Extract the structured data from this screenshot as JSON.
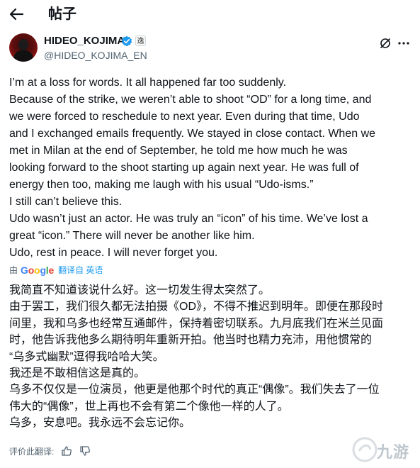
{
  "header": {
    "title": "帖子",
    "back_icon": "arrow-left-icon"
  },
  "author": {
    "display_name": "HIDEO_KOJIMA",
    "handle": "@HIDEO_KOJIMA_EN",
    "affiliate_badge": "逸",
    "verified_color": "#1d9bf0"
  },
  "post": {
    "lines": [
      "I’m at a loss for words. It all happened far too suddenly.",
      "Because of the strike, we weren’t able to shoot “OD” for a long time, and",
      "we were forced to reschedule to next year. Even during that time, Udo",
      "and I exchanged emails frequently. We stayed in close contact. When we",
      "met in Milan at the end of September, he told me how much he was",
      "looking forward to the shoot starting up again next year. He was full of",
      "energy then too, making me laugh with his usual “Udo-isms.”",
      "I still can’t believe this.",
      "Udo wasn’t just an actor. He was truly an “icon” of his time. We’ve lost a",
      "great “icon.” There will never be another like him.",
      "Udo, rest in peace. I will never forget you."
    ]
  },
  "translation": {
    "by_label": "由",
    "provider": "Google",
    "link_label": "翻译自 英语",
    "lines": [
      "我简直不知道该说什么好。这一切发生得太突然了。",
      "由于罢工，我们很久都无法拍摄《OD》，不得不推迟到明年。即便在那段时",
      "间里，我和乌多也经常互通邮件，保持着密切联系。九月底我们在米兰见面",
      "时，他告诉我他多么期待明年重新开拍。他当时也精力充沛，用他惯常的",
      "“乌多式幽默”逗得我哈哈大笑。",
      "我还是不敢相信这是真的。",
      "乌多不仅仅是一位演员，他更是他那个时代的真正“偶像”。我们失去了一位",
      "伟大的“偶像”，世上再也不会有第二个像他一样的人了。",
      "乌多，安息吧。我永远不会忘记你。"
    ],
    "rate_label": "评价此翻译:"
  },
  "watermark": {
    "text": "九游"
  },
  "colors": {
    "accent": "#1d9bf0",
    "secondary_text": "#536471"
  }
}
